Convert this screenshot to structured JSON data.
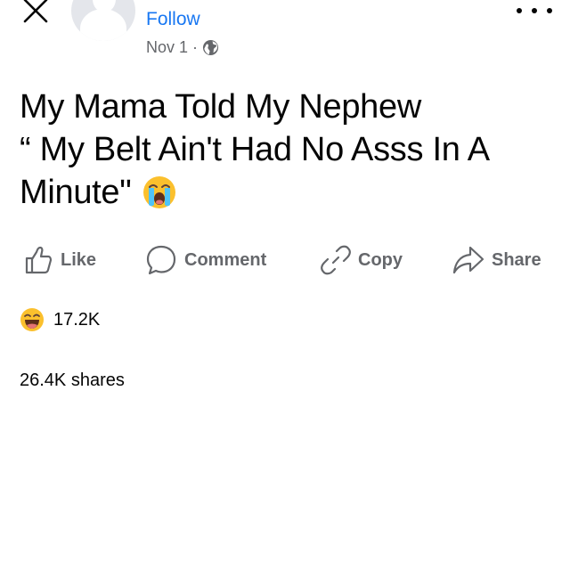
{
  "header": {
    "follow_label": "Follow",
    "date": "Nov 1",
    "separator": "·",
    "privacy_icon": "globe-icon"
  },
  "post": {
    "lines": [
      "My Mama Told My Nephew",
      "“ My Belt Ain't Had No Asss In A",
      "Minute\""
    ],
    "emoji": "loudly-crying-face-emoji"
  },
  "actions": {
    "like": "Like",
    "comment": "Comment",
    "copy": "Copy",
    "share": "Share"
  },
  "reactions": {
    "emoji": "laughing-face-emoji",
    "count": "17.2K"
  },
  "shares": {
    "label": "26.4K shares"
  },
  "colors": {
    "link": "#1877f2",
    "muted": "#65676b",
    "text": "#050505",
    "emoji_yellow": "#fbc02d"
  }
}
